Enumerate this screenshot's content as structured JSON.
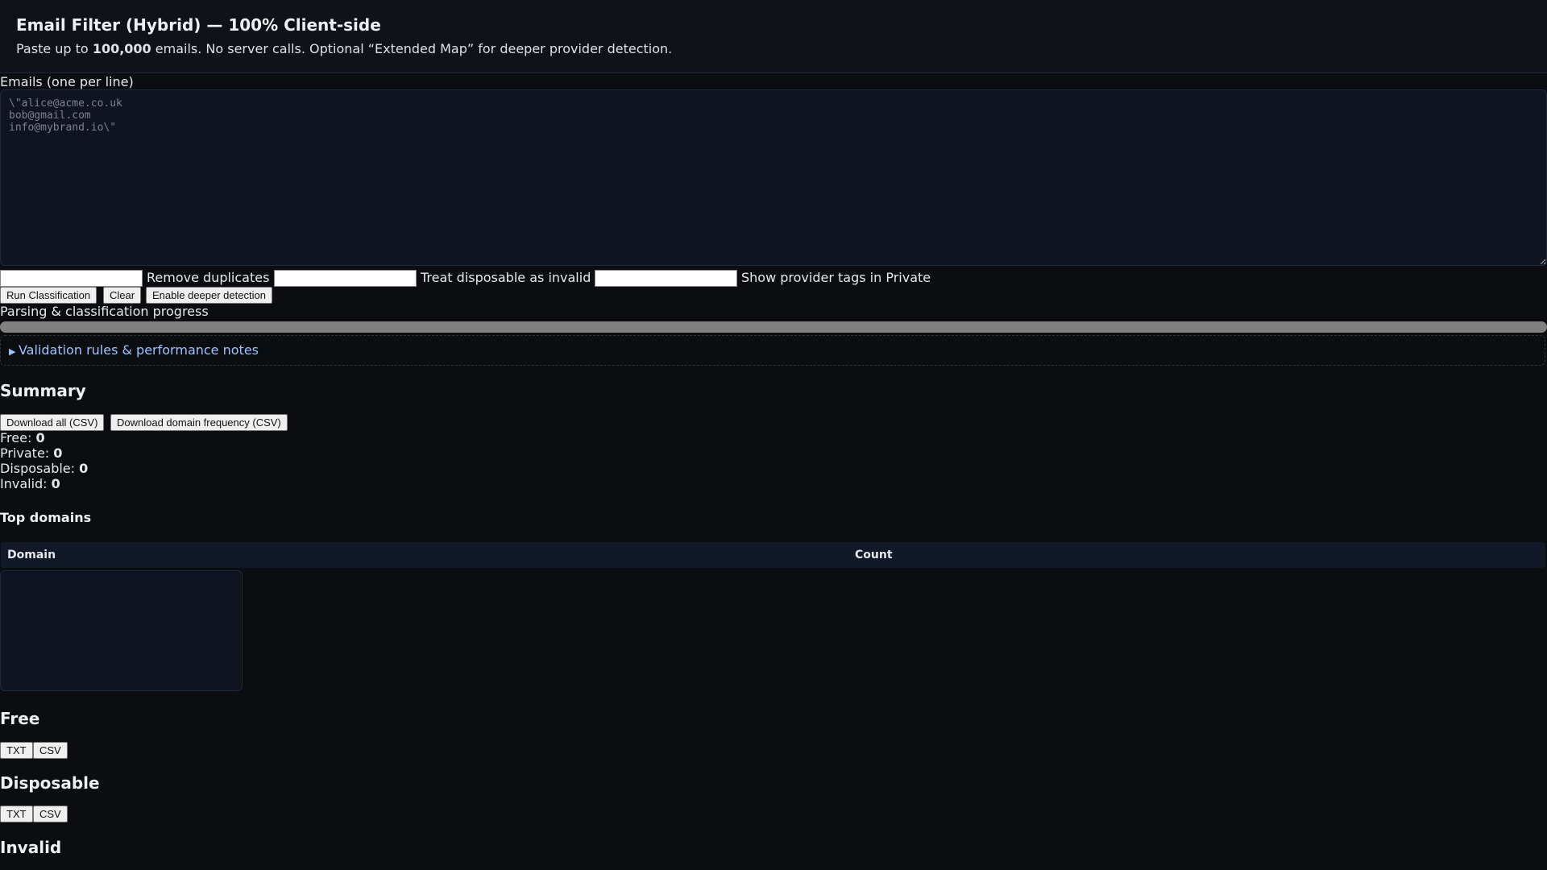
{
  "header": {
    "title": "Email Filter (Hybrid) — 100% Client-side",
    "subtitle_pre": "Paste up to ",
    "subtitle_bold": "100,000",
    "subtitle_post": " emails. No server calls. Optional “Extended Map” for deeper provider detection."
  },
  "input": {
    "label": "Emails (one per line)",
    "placeholder": "\\\"alice@acme.co.uk\nbob@gmail.com\ninfo@mybrand.io\\\"",
    "value": ""
  },
  "options": [
    {
      "label": "Remove duplicates"
    },
    {
      "label": "Treat disposable as invalid"
    },
    {
      "label": "Show provider tags in Private"
    }
  ],
  "actions": {
    "run": "Run Classification",
    "clear": "Clear",
    "deeper": "Enable deeper detection"
  },
  "progress": {
    "label": "Parsing & classification progress",
    "value": 0
  },
  "details": {
    "summary": "Validation rules & performance notes"
  },
  "summary": {
    "heading": "Summary",
    "download_all": "Download all (CSV)",
    "download_freq": "Download domain frequency (CSV)",
    "stats": [
      {
        "label": "Free: ",
        "value": "0"
      },
      {
        "label": "Private: ",
        "value": "0"
      },
      {
        "label": "Disposable: ",
        "value": "0"
      },
      {
        "label": "Invalid: ",
        "value": "0"
      }
    ]
  },
  "top_domains": {
    "heading": "Top domains",
    "columns": [
      "Domain",
      "Count"
    ]
  },
  "sections": [
    {
      "heading": "Free",
      "txt": "TXT",
      "csv": "CSV"
    },
    {
      "heading": "Disposable",
      "txt": "TXT",
      "csv": "CSV"
    },
    {
      "heading": "Invalid"
    }
  ]
}
